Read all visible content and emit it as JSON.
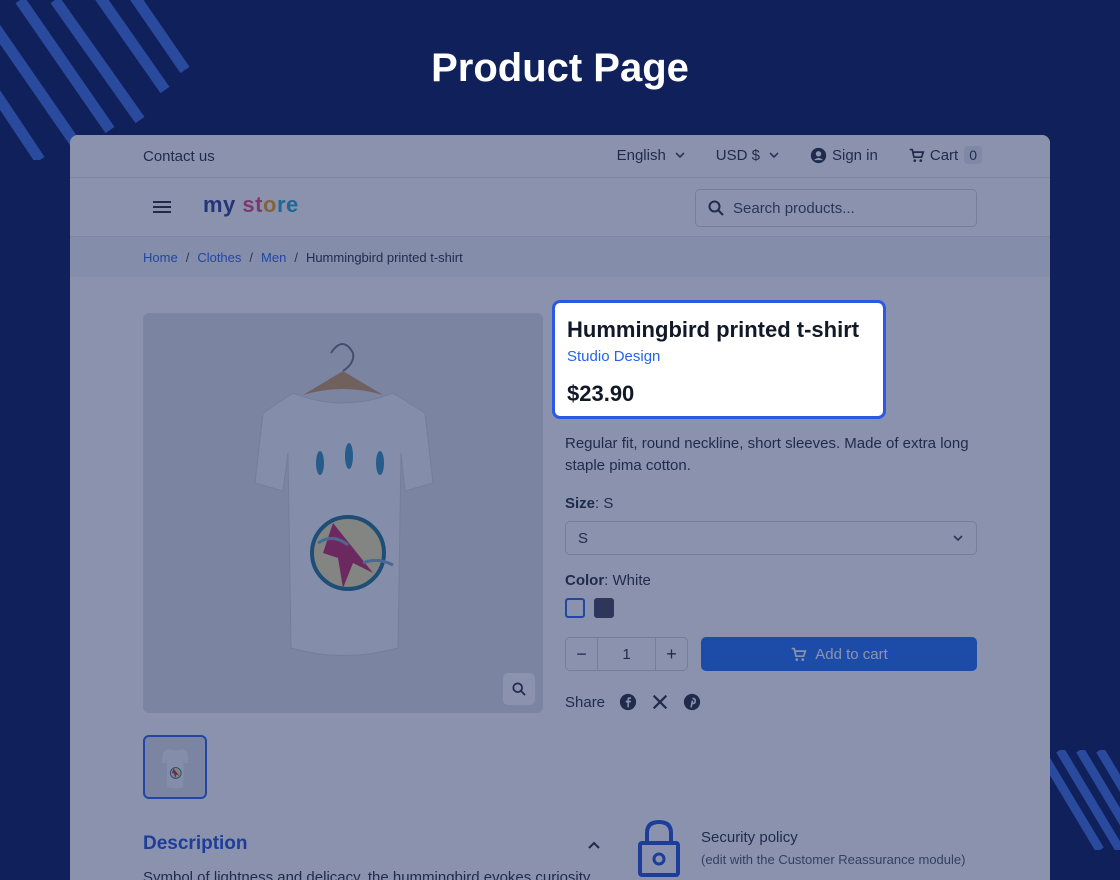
{
  "page_heading": "Product Page",
  "topbar": {
    "contact": "Contact us",
    "language": "English",
    "currency": "USD $",
    "sign_in": "Sign in",
    "cart_label": "Cart",
    "cart_count": "0"
  },
  "header": {
    "logo_text": "my store",
    "search_placeholder": "Search products..."
  },
  "breadcrumb": {
    "items": [
      "Home",
      "Clothes",
      "Men"
    ],
    "current": "Hummingbird printed t-shirt"
  },
  "product": {
    "title": "Hummingbird printed t-shirt",
    "brand": "Studio Design",
    "price": "$23.90",
    "short_description": "Regular fit, round neckline, short sleeves. Made of extra long staple pima cotton.",
    "size_label": "Size",
    "size_value": "S",
    "size_selected": "S",
    "color_label": "Color",
    "color_value": "White",
    "colors": [
      "#ffffff",
      "#3b4252"
    ],
    "quantity": "1",
    "add_to_cart": "Add to cart",
    "share_label": "Share"
  },
  "description": {
    "heading": "Description",
    "body": "Symbol of lightness and delicacy, the hummingbird evokes curiosity"
  },
  "reassurance": {
    "title": "Security policy",
    "subtitle": "(edit with the Customer Reassurance module)"
  },
  "colors": {
    "background": "#10205a",
    "accent": "#2b59e6",
    "link": "#2563eb",
    "button": "#1d6ef5"
  }
}
